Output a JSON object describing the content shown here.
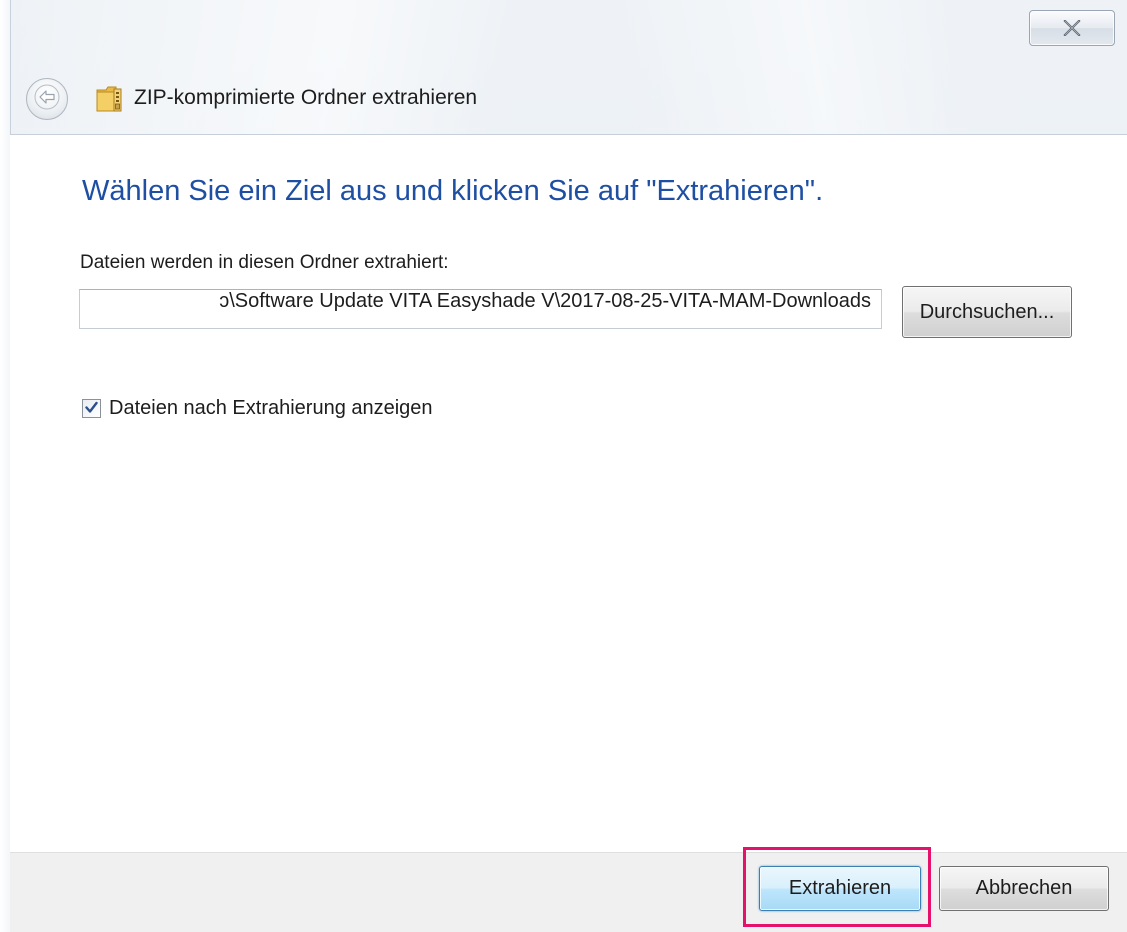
{
  "window": {
    "title": "ZIP-komprimierte Ordner extrahieren"
  },
  "main": {
    "heading": "Wählen Sie ein Ziel aus und klicken Sie auf \"Extrahieren\".",
    "folder_label": "Dateien werden in diesen Ordner extrahiert:",
    "path_value": "\\Software Update VITA Easyshade V\\2017-08-25-VITA-MAM-Downloads",
    "path_value_visible_prefix": "ɔ",
    "browse_label": "Durchsuchen...",
    "checkbox": {
      "label": "Dateien nach Extrahierung anzeigen",
      "checked": true
    }
  },
  "footer": {
    "extract_label": "Extrahieren",
    "cancel_label": "Abbrechen"
  },
  "icons": {
    "close": "close-icon",
    "back": "back-arrow-icon",
    "zip_folder": "zip-folder-icon",
    "checkmark": "checkmark-icon"
  },
  "colors": {
    "heading": "#1e4fa3",
    "highlight": "#e5116b",
    "default_button_border": "#3c7fb1"
  }
}
